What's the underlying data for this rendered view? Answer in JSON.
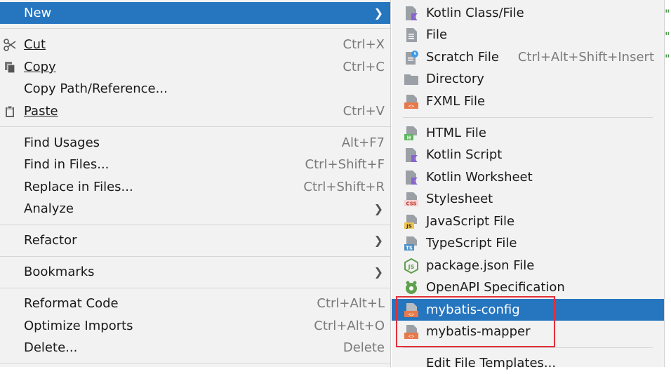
{
  "menu": {
    "new": {
      "label": "New"
    },
    "cut": {
      "label": "Cut",
      "shortcut": "Ctrl+X"
    },
    "copy": {
      "label": "Copy",
      "shortcut": "Ctrl+C"
    },
    "copy_path": {
      "label": "Copy Path/Reference..."
    },
    "paste": {
      "label": "Paste",
      "shortcut": "Ctrl+V"
    },
    "find_usages": {
      "label": "Find Usages",
      "shortcut": "Alt+F7"
    },
    "find_in_files": {
      "label": "Find in Files...",
      "shortcut": "Ctrl+Shift+F"
    },
    "replace_in_files": {
      "label": "Replace in Files...",
      "shortcut": "Ctrl+Shift+R"
    },
    "analyze": {
      "label": "Analyze"
    },
    "refactor": {
      "label": "Refactor"
    },
    "bookmarks": {
      "label": "Bookmarks"
    },
    "reformat": {
      "label": "Reformat Code",
      "shortcut": "Ctrl+Alt+L"
    },
    "optimize": {
      "label": "Optimize Imports",
      "shortcut": "Ctrl+Alt+O"
    },
    "delete": {
      "label": "Delete...",
      "shortcut": "Delete"
    }
  },
  "submenu": {
    "items": [
      {
        "label": "Kotlin Class/File",
        "icon": "kotlin-file-icon"
      },
      {
        "label": "File",
        "icon": "file-icon"
      },
      {
        "label": "Scratch File",
        "shortcut": "Ctrl+Alt+Shift+Insert",
        "icon": "scratch-file-icon"
      },
      {
        "label": "Directory",
        "icon": "folder-icon"
      },
      {
        "label": "FXML File",
        "icon": "fxml-file-icon"
      },
      {
        "label": "HTML File",
        "icon": "html-file-icon"
      },
      {
        "label": "Kotlin Script",
        "icon": "kotlin-script-icon"
      },
      {
        "label": "Kotlin Worksheet",
        "icon": "kotlin-worksheet-icon"
      },
      {
        "label": "Stylesheet",
        "icon": "css-file-icon"
      },
      {
        "label": "JavaScript File",
        "icon": "js-file-icon"
      },
      {
        "label": "TypeScript File",
        "icon": "ts-file-icon"
      },
      {
        "label": "package.json File",
        "icon": "nodejs-icon"
      },
      {
        "label": "OpenAPI Specification",
        "icon": "openapi-icon"
      },
      {
        "label": "mybatis-config",
        "icon": "xml-template-icon"
      },
      {
        "label": "mybatis-mapper",
        "icon": "xml-template-icon"
      },
      {
        "label": "Edit File Templates..."
      }
    ]
  },
  "colors": {
    "highlight": "#2675bf",
    "annotation": "#e0303a"
  }
}
